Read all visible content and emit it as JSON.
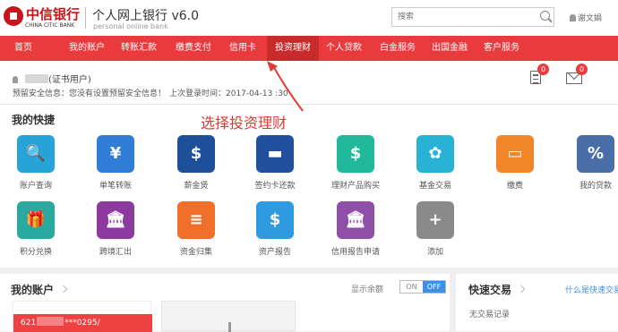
{
  "brand": {
    "name_cn": "中信银行",
    "name_en": "CHINA CITIC BANK",
    "product_title": "个人网上银行 v6.0",
    "product_subtitle": "personal online bank"
  },
  "search": {
    "placeholder": "搜索"
  },
  "top_user": {
    "name": "谢文娟"
  },
  "nav": {
    "items": [
      "首页",
      "我的账户",
      "转账汇款",
      "缴费支付",
      "信用卡",
      "投资理财",
      "个人贷款",
      "白金服务",
      "出国金融",
      "客户服务"
    ],
    "active_index": 5
  },
  "user": {
    "name_suffix": "(证书用户)",
    "safety_notice": "预留安全信息：您没有设置预留安全信息！",
    "last_login": "上次登录时间：2017-04-13 ",
    "last_login_tail": ":30",
    "message_count": "0",
    "mail_count": "0"
  },
  "annotation": "选择投资理财",
  "quick": {
    "title": "我的快捷",
    "tiles": [
      {
        "label": "账户查询",
        "color": "#27a3d9",
        "icon": "account-search-icon",
        "glyph": "🔍"
      },
      {
        "label": "单笔转账",
        "color": "#2f7dd6",
        "icon": "transfer-icon",
        "glyph": "¥"
      },
      {
        "label": "薪金煲",
        "color": "#1e4f99",
        "icon": "salary-icon",
        "glyph": "$"
      },
      {
        "label": "签约卡还款",
        "color": "#22509e",
        "icon": "card-repay-icon",
        "glyph": "▬"
      },
      {
        "label": "理财产品购买",
        "color": "#21b89c",
        "icon": "wealth-purchase-icon",
        "glyph": "$"
      },
      {
        "label": "基金交易",
        "color": "#28b3d6",
        "icon": "fund-icon",
        "glyph": "✿"
      },
      {
        "label": "缴费",
        "color": "#f0852a",
        "icon": "wallet-icon",
        "glyph": "▭"
      },
      {
        "label": "我的贷款",
        "color": "#4a6fa8",
        "icon": "loan-icon",
        "glyph": "%"
      },
      {
        "label": "积分兑换",
        "color": "#2aa9a0",
        "icon": "gift-icon",
        "glyph": "🎁"
      },
      {
        "label": "跨境汇出",
        "color": "#8d3aa0",
        "icon": "crossborder-icon",
        "glyph": "🏛"
      },
      {
        "label": "资金归集",
        "color": "#f06f2a",
        "icon": "fund-collect-icon",
        "glyph": "≡"
      },
      {
        "label": "资产报告",
        "color": "#2e9be0",
        "icon": "asset-report-icon",
        "glyph": "$"
      },
      {
        "label": "信用报告申请",
        "color": "#8e4fa8",
        "icon": "credit-report-icon",
        "glyph": "🏛"
      },
      {
        "label": "添加",
        "color": "#8a8a8a",
        "icon": "add-icon",
        "glyph": "+"
      }
    ]
  },
  "accounts": {
    "title": "我的账户",
    "show_balance_label": "显示余额",
    "toggle_on": "ON",
    "toggle_off": "OFF",
    "card_prefix": "621",
    "card_suffix": "***0295/"
  },
  "fast_trade": {
    "title": "快速交易",
    "help_link": "什么是快速交易",
    "empty_text": "无交易记录"
  }
}
